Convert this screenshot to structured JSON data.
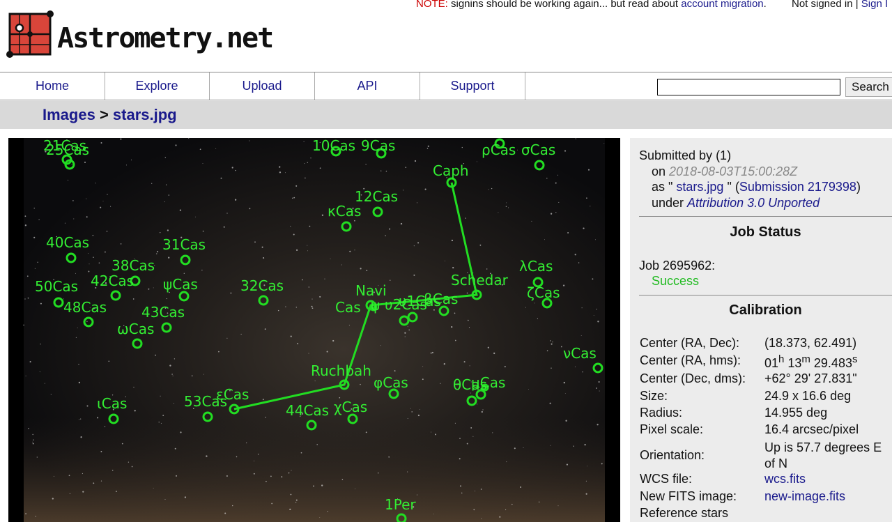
{
  "notice": {
    "label": "NOTE:",
    "text": " signins should be working again... but read about ",
    "link": "account migration",
    "tail": "."
  },
  "auth": {
    "status": "Not signed in | ",
    "sign_link": "Sign I"
  },
  "logo": {
    "text": "Astrometry.net"
  },
  "nav": {
    "items": [
      {
        "label": "Home"
      },
      {
        "label": "Explore"
      },
      {
        "label": "Upload"
      },
      {
        "label": "API"
      },
      {
        "label": "Support"
      }
    ],
    "search_button": "Search",
    "search_value": ""
  },
  "breadcrumb": {
    "root": "Images",
    "sep": " > ",
    "current": "stars.jpg"
  },
  "submission": {
    "submitted_by": "Submitted by ",
    "user": "(1)",
    "on_label": "on ",
    "date": "2018-08-03T15:00:28Z",
    "as_label": "as \" ",
    "file": "stars.jpg",
    "as_mid": " \" (",
    "submission_link": "Submission 2179398",
    "as_end": ")",
    "under_label": "under ",
    "license": "Attribution 3.0 Unported"
  },
  "job_status": {
    "title": "Job Status",
    "job_label": "Job 2695962:",
    "status": "Success"
  },
  "calibration": {
    "title": "Calibration",
    "rows": [
      {
        "k": "Center (RA, Dec):",
        "v": "(18.373, 62.491)"
      },
      {
        "k": "Center (RA, hms):",
        "v": "01h 13m 29.483s"
      },
      {
        "k": "Center (Dec, dms):",
        "v": "+62° 29' 27.831\""
      },
      {
        "k": "Size:",
        "v": "24.9 x 16.6 deg"
      },
      {
        "k": "Radius:",
        "v": "14.955 deg"
      },
      {
        "k": "Pixel scale:",
        "v": "16.4 arcsec/pixel"
      },
      {
        "k": "Orientation:",
        "v": "Up is 57.7 degrees E of N"
      },
      {
        "k": "WCS file:",
        "v": "wcs.fits",
        "link": true
      },
      {
        "k": "New FITS image:",
        "v": "new-image.fits",
        "link": true
      },
      {
        "k": "Reference stars",
        "v": ""
      }
    ],
    "hms": {
      "h": "01",
      "h_sup": "h",
      "m": " 13",
      "m_sup": "m",
      "s": " 29.483",
      "s_sup": "s"
    }
  },
  "star_labels": [
    "21Cas",
    "25Cas",
    "10Cas",
    "9Cas",
    "ρCas",
    "σCas",
    "Caph",
    "12Cas",
    "κCas",
    "40Cas",
    "31Cas",
    "38Cas",
    "50Cas",
    "42Cas",
    "ψCas",
    "32Cas",
    "Navi",
    "Schedar",
    "λCas",
    "ζCas",
    "48Cas",
    "43Cas",
    "ωCas",
    "Cas",
    "ψ",
    "υ2Cas",
    "υ1Cas",
    "βCas",
    "νCas",
    "Ruchbah",
    "φCas",
    "θCas",
    "μCas",
    "ιCas",
    "53Cas",
    "εCas",
    "44Cas",
    "χCas",
    "1Per"
  ],
  "colors": {
    "link": "#1a1a8c",
    "note": "#cc0000",
    "success": "#22bb22",
    "overlay": "#22dd22",
    "sidebar": "#ececec",
    "crumbbar": "#d9d9d9"
  }
}
